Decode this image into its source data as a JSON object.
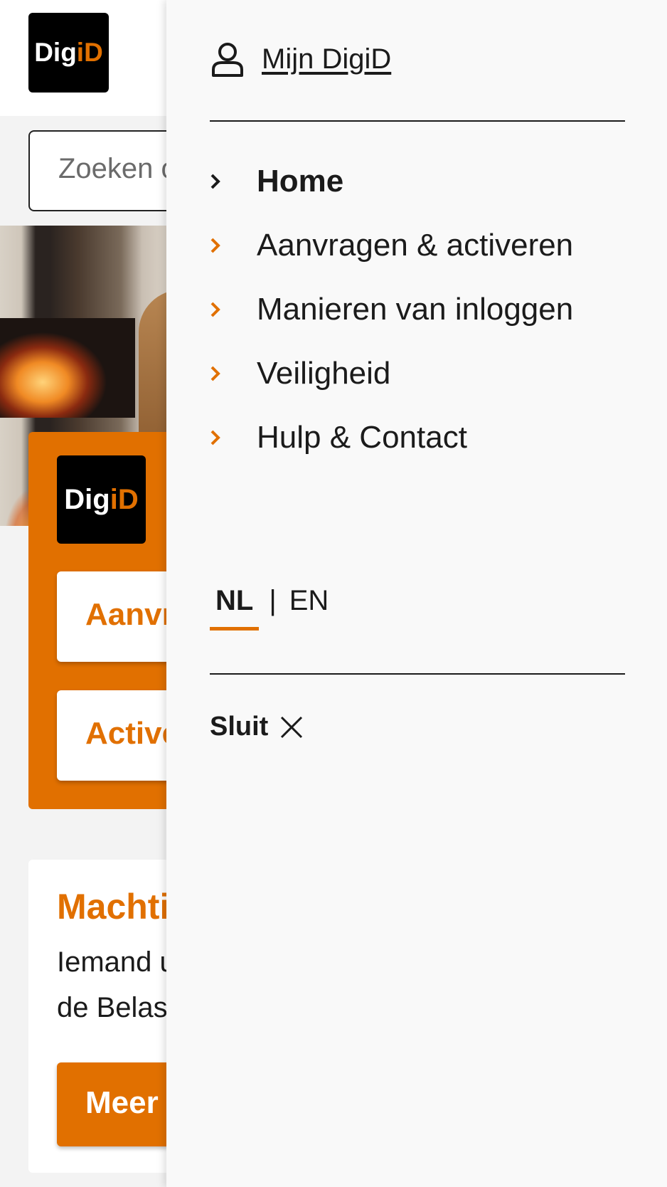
{
  "brand": {
    "logo_text_main": "Dig",
    "logo_text_accent": "iD",
    "accent_color": "#e17000"
  },
  "search": {
    "placeholder": "Zoeken op"
  },
  "page": {
    "card_1": "Aanvragen",
    "card_2": "Activeren",
    "info_title": "Machtigen",
    "info_line_1": "Iemand u",
    "info_line_2": "de Belast",
    "more_button": "Meer"
  },
  "drawer": {
    "account_link": "Mijn DigiD",
    "nav": [
      {
        "label": "Home",
        "active": true
      },
      {
        "label": "Aanvragen & activeren",
        "active": false
      },
      {
        "label": "Manieren van inloggen",
        "active": false
      },
      {
        "label": "Veiligheid",
        "active": false
      },
      {
        "label": "Hulp & Contact",
        "active": false
      }
    ],
    "lang": {
      "nl": "NL",
      "separator": "|",
      "en": "EN",
      "selected": "NL"
    },
    "close_label": "Sluit"
  },
  "icons": {
    "account": "user-icon",
    "nav": "chevron-right-icon",
    "close": "close-icon"
  }
}
